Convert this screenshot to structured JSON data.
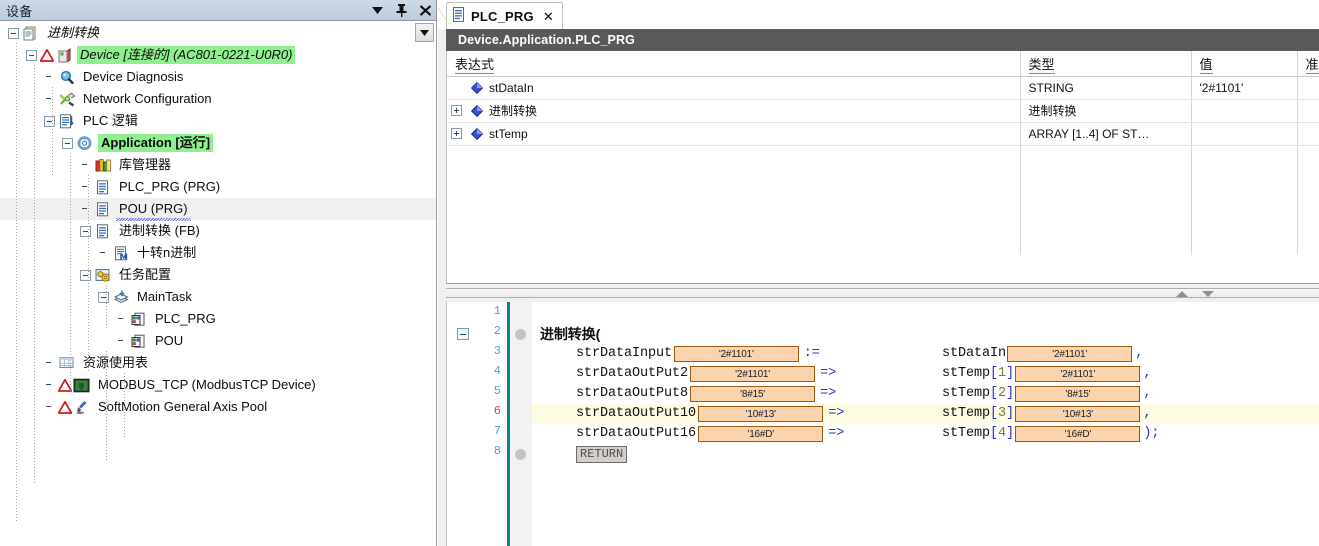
{
  "panel": {
    "title": "设备",
    "buttons": [
      {
        "name": "dropdown",
        "glyph": "▼"
      },
      {
        "name": "pin",
        "glyph": "📌"
      },
      {
        "name": "close",
        "glyph": "✕"
      }
    ]
  },
  "tree": [
    {
      "indent": 0,
      "expander": "minus",
      "icon": "project-icon",
      "label": "进制转换",
      "style": "italic",
      "highlight": "none"
    },
    {
      "indent": 1,
      "expander": "minus",
      "icon": "device-icon",
      "label": "Device [连接的] (AC801-0221-U0R0)",
      "style": "italic",
      "highlight": "green",
      "warning": true
    },
    {
      "indent": 2,
      "expander": "none",
      "icon": "diagnosis-icon",
      "label": "Device Diagnosis",
      "style": "normal",
      "highlight": "none"
    },
    {
      "indent": 2,
      "expander": "none",
      "icon": "network-icon",
      "label": "Network Configuration",
      "style": "normal",
      "highlight": "none"
    },
    {
      "indent": 2,
      "expander": "minus",
      "icon": "plc-logic-icon",
      "label": "PLC 逻辑",
      "style": "normal",
      "highlight": "none"
    },
    {
      "indent": 3,
      "expander": "minus",
      "icon": "application-icon",
      "label": "Application [运行]",
      "style": "bold",
      "highlight": "green"
    },
    {
      "indent": 4,
      "expander": "none",
      "icon": "library-icon",
      "label": "库管理器",
      "style": "normal",
      "highlight": "none"
    },
    {
      "indent": 4,
      "expander": "none",
      "icon": "pou-prg-icon",
      "label": "PLC_PRG (PRG)",
      "style": "normal",
      "highlight": "none"
    },
    {
      "indent": 4,
      "expander": "none",
      "icon": "pou-prg-icon",
      "label": "POU (PRG)",
      "style": "squiggle",
      "highlight": "row"
    },
    {
      "indent": 4,
      "expander": "minus",
      "icon": "pou-prg-icon",
      "label": "进制转换 (FB)",
      "style": "normal",
      "highlight": "none"
    },
    {
      "indent": 5,
      "expander": "none",
      "icon": "method-icon",
      "label": "十转n进制",
      "style": "normal",
      "highlight": "none"
    },
    {
      "indent": 4,
      "expander": "minus",
      "icon": "task-config-icon",
      "label": "任务配置",
      "style": "normal",
      "highlight": "none"
    },
    {
      "indent": 5,
      "expander": "minus",
      "icon": "task-icon",
      "label": "MainTask",
      "style": "normal",
      "highlight": "none"
    },
    {
      "indent": 6,
      "expander": "none",
      "icon": "task-call-icon",
      "label": "PLC_PRG",
      "style": "normal",
      "highlight": "none"
    },
    {
      "indent": 6,
      "expander": "none",
      "icon": "task-call-icon",
      "label": "POU",
      "style": "normal",
      "highlight": "none"
    },
    {
      "indent": 2,
      "expander": "none",
      "icon": "resource-table-icon",
      "label": "资源使用表",
      "style": "normal",
      "highlight": "none"
    },
    {
      "indent": 2,
      "expander": "none",
      "icon": "modbus-icon",
      "label": "MODBUS_TCP (ModbusTCP Device)",
      "style": "normal",
      "highlight": "none",
      "warning": true
    },
    {
      "indent": 2,
      "expander": "none",
      "icon": "softmotion-icon",
      "label": "SoftMotion General Axis Pool",
      "style": "normal",
      "highlight": "none",
      "warning": true
    }
  ],
  "tab": {
    "label": "PLC_PRG",
    "close_glyph": "✕",
    "icon": "pou-prg-icon"
  },
  "path_bar": {
    "text": "Device.Application.PLC_PRG"
  },
  "watch": {
    "columns": [
      "表达式",
      "类型",
      "值",
      "准备"
    ],
    "rows": [
      {
        "expandable": false,
        "expression": "stDataIn",
        "type": "STRING",
        "value": "'2#1101'",
        "prepared": ""
      },
      {
        "expandable": true,
        "expression": "进制转换",
        "type": "进制转换",
        "value": "",
        "prepared": ""
      },
      {
        "expandable": true,
        "expression": "stTemp",
        "type": "ARRAY [1..4] OF ST…",
        "value": "",
        "prepared": ""
      }
    ]
  },
  "splitter": {
    "up_glyph": "▲",
    "down_glyph": "▼"
  },
  "code": {
    "current_line": 6,
    "lines": [
      {
        "n": 1,
        "breakpoint": false,
        "fold": false,
        "highlight": false,
        "text": ""
      },
      {
        "n": 2,
        "breakpoint": true,
        "fold": true,
        "highlight": false,
        "text": "进制转换("
      },
      {
        "n": 3,
        "breakpoint": false,
        "fold": false,
        "highlight": false,
        "text": "    strDataInput"
      },
      {
        "n": 4,
        "breakpoint": false,
        "fold": false,
        "highlight": false,
        "text": "    strDataOutPut2"
      },
      {
        "n": 5,
        "breakpoint": false,
        "fold": false,
        "highlight": false,
        "text": "    strDataOutPut8"
      },
      {
        "n": 6,
        "breakpoint": false,
        "fold": false,
        "highlight": true,
        "text": "    strDataOutPut10"
      },
      {
        "n": 7,
        "breakpoint": false,
        "fold": false,
        "highlight": false,
        "text": "    strDataOutPut16"
      },
      {
        "n": 8,
        "breakpoint": true,
        "fold": false,
        "highlight": false,
        "text": "    RETURN"
      }
    ],
    "call_header": "进制转换(",
    "params": [
      {
        "line": 3,
        "left_name": "strDataInput",
        "left_value": "'2#1101'",
        "operator": ":=",
        "right_name": "stDataIn",
        "right_value": "'2#1101'",
        "terminator": ","
      },
      {
        "line": 4,
        "left_name": "strDataOutPut2",
        "left_value": "'2#1101'",
        "operator": "=>",
        "right_name": "stTemp[1]",
        "right_value": "'2#1101'",
        "terminator": ","
      },
      {
        "line": 5,
        "left_name": "strDataOutPut8",
        "left_value": "'8#15'",
        "operator": "=>",
        "right_name": "stTemp[2]",
        "right_value": "'8#15'",
        "terminator": ","
      },
      {
        "line": 6,
        "left_name": "strDataOutPut10",
        "left_value": "'10#13'",
        "operator": "=>",
        "right_name": "stTemp[3]",
        "right_value": "'10#13'",
        "terminator": ","
      },
      {
        "line": 7,
        "left_name": "strDataOutPut16",
        "left_value": "'16#D'",
        "operator": "=>",
        "right_name": "stTemp[4]",
        "right_value": "'16#D'",
        "terminator": ");"
      }
    ],
    "return_keyword": "RETURN"
  },
  "colors": {
    "selection_green": "#8ef08e",
    "path_bar_bg": "#595959",
    "value_box_bg": "#fbd4ad",
    "value_box_border": "#9a5a16",
    "current_line_bg": "#fdfbe2",
    "line_number": "#5b9bd5",
    "current_line_number": "#d64545",
    "teal_bar": "#0f8189"
  }
}
